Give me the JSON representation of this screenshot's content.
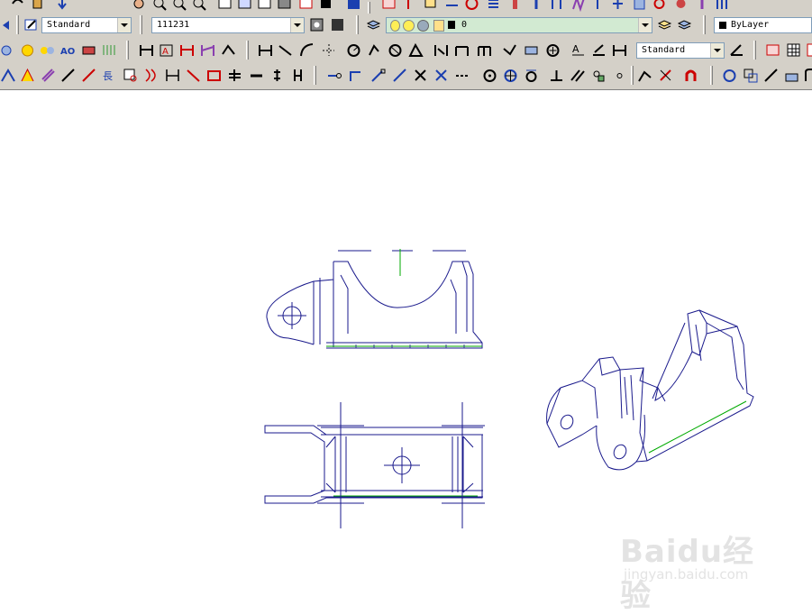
{
  "toolbar": {
    "text_style": "Standard",
    "layer_state": "111231",
    "current_layer": "0",
    "dim_style": "Standard",
    "color_control": "ByLayer"
  },
  "colors": {
    "toolbar_bg": "#d4d0c8",
    "drawing_line": "#1a1a8c",
    "center_line": "#00aa00",
    "canvas_bg": "#ffffff"
  },
  "watermark": {
    "logo": "Baidu经验",
    "url": "jingyan.baidu.com"
  }
}
